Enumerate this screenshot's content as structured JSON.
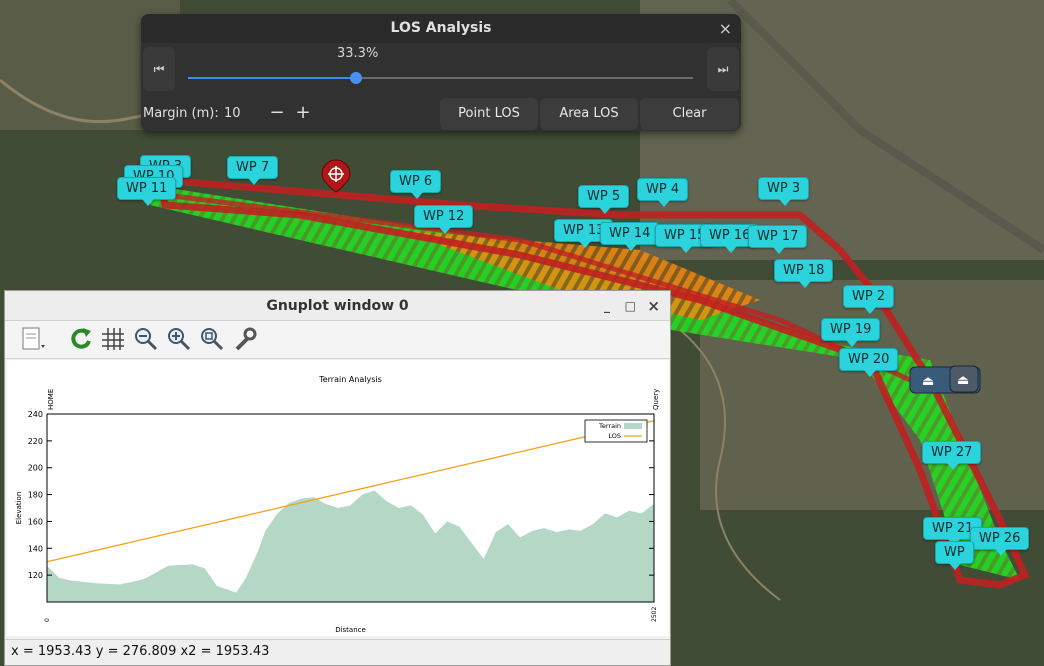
{
  "map": {
    "waypoints": [
      {
        "label": "WP 3"
      },
      {
        "label": "WP 7"
      },
      {
        "label": "WP 10"
      },
      {
        "label": "WP 11"
      },
      {
        "label": "WP 6"
      },
      {
        "label": "WP 12"
      },
      {
        "label": "WP 5"
      },
      {
        "label": "WP 4"
      },
      {
        "label": "WP 3"
      },
      {
        "label": "WP 13"
      },
      {
        "label": "WP 14"
      },
      {
        "label": "WP 15"
      },
      {
        "label": "WP 16"
      },
      {
        "label": "WP 17"
      },
      {
        "label": "WP 18"
      },
      {
        "label": "WP 2"
      },
      {
        "label": "WP 19"
      },
      {
        "label": "WP 20"
      },
      {
        "label": "WP 27"
      },
      {
        "label": "WP 21"
      },
      {
        "label": "WP 26"
      },
      {
        "label": "WP"
      }
    ],
    "home_icon": "eject-icon",
    "marker_icon": "crosshair-icon"
  },
  "los": {
    "title": "LOS Analysis",
    "progress_text": "33.3%",
    "progress": 0.333,
    "margin_label": "Margin (m):",
    "margin_value": "10",
    "minus": "−",
    "plus": "+",
    "point_los": "Point LOS",
    "area_los": "Area LOS",
    "clear": "Clear",
    "close": "×",
    "skip_back": "⏮",
    "skip_fwd": "⏭"
  },
  "gnuplot": {
    "title": "Gnuplot window 0",
    "minimize": "_",
    "maximize": "□",
    "close": "×",
    "status": "x = 1953.43 y = 276.809 x2 = 1953.43"
  },
  "chart_data": {
    "type": "area",
    "title": "Terrain Analysis",
    "xlabel": "Distance",
    "ylabel": "Elevation",
    "xlim": [
      0,
      2502
    ],
    "ylim": [
      100,
      240
    ],
    "yticks": [
      120,
      140,
      160,
      180,
      200,
      220,
      240
    ],
    "x_tick_labels": [
      "0",
      "2502"
    ],
    "top_labels": [
      "HOME",
      "Query"
    ],
    "grid": false,
    "legend_position": "top-right",
    "series": [
      {
        "name": "Terrain",
        "type": "area",
        "color": "#b4d7c6",
        "x": [
          0,
          50,
          100,
          200,
          300,
          400,
          500,
          600,
          650,
          700,
          780,
          820,
          870,
          900,
          950,
          1000,
          1050,
          1100,
          1150,
          1200,
          1250,
          1300,
          1350,
          1400,
          1450,
          1500,
          1550,
          1600,
          1650,
          1700,
          1750,
          1800,
          1850,
          1900,
          1950,
          2000,
          2050,
          2100,
          2150,
          2200,
          2250,
          2300,
          2350,
          2400,
          2450,
          2502
        ],
        "values": [
          127,
          118,
          116,
          114,
          113,
          117,
          127,
          128,
          125,
          112,
          107,
          118,
          138,
          153,
          166,
          174,
          177,
          178,
          173,
          170,
          172,
          180,
          183,
          175,
          170,
          172,
          165,
          151,
          160,
          156,
          144,
          132,
          152,
          158,
          148,
          153,
          155,
          152,
          154,
          153,
          158,
          166,
          163,
          168,
          166,
          173
        ]
      },
      {
        "name": "LOS",
        "type": "line",
        "color": "#f5a01a",
        "x": [
          0,
          2502
        ],
        "values": [
          130,
          235
        ]
      }
    ]
  }
}
